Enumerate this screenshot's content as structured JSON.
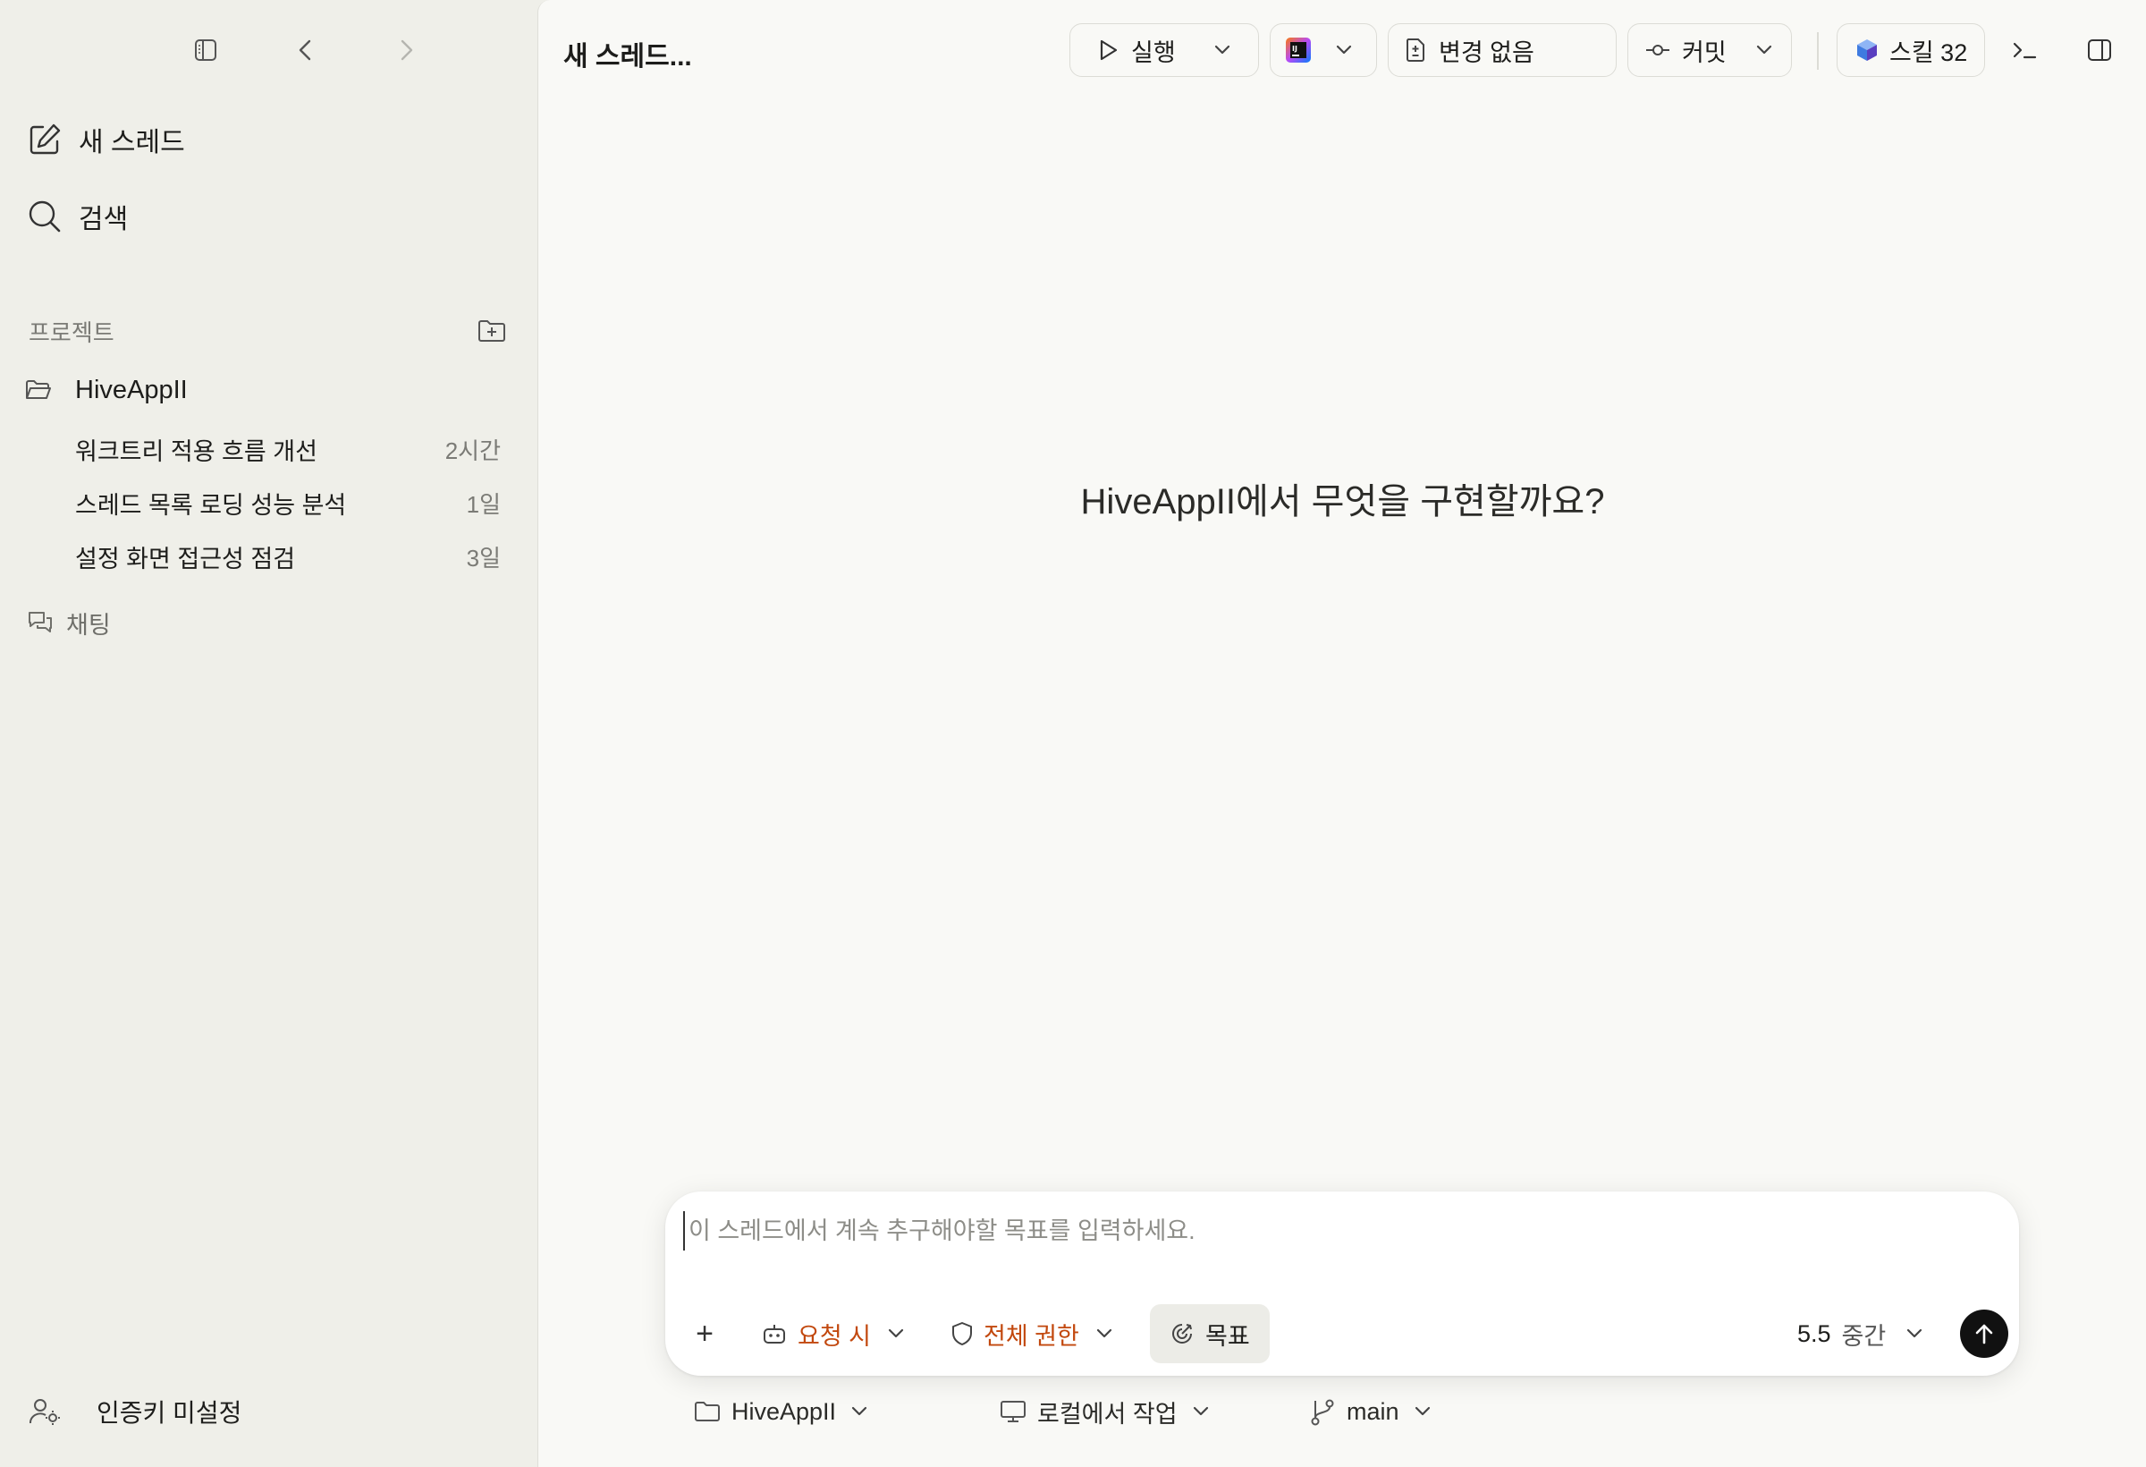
{
  "sidebar": {
    "nav": {
      "new_thread": "새 스레드",
      "search": "검색"
    },
    "projects_label": "프로젝트",
    "project": {
      "name": "HiveAppII",
      "threads": [
        {
          "title": "워크트리 적용 흐름 개선",
          "age": "2시간"
        },
        {
          "title": "스레드 목록 로딩 성능 분석",
          "age": "1일"
        },
        {
          "title": "설정 화면 접근성 점검",
          "age": "3일"
        }
      ]
    },
    "chat_label": "채팅",
    "auth_label": "인증키 미설정"
  },
  "header": {
    "thread_title": "새 스레드...",
    "run_label": "실행",
    "changes_label": "변경 없음",
    "commit_label": "커밋",
    "skills_label": "스킬 32"
  },
  "main": {
    "headline": "HiveAppII에서 무엇을 구현할까요?"
  },
  "composer": {
    "placeholder": "이 스레드에서 계속 추구해야할 목표를 입력하세요.",
    "plus": "+",
    "approval_label": "요청 시",
    "permission_label": "전체 권한",
    "goal_label": "목표",
    "model_version": "5.5",
    "model_effort": "중간"
  },
  "footer": {
    "project": "HiveAppII",
    "environment": "로컬에서 작업",
    "branch": "main"
  },
  "colors": {
    "accent_orange": "#c2480e",
    "sidebar_bg": "#efefe9",
    "main_bg": "#f9f9f6",
    "send_button": "#111111"
  }
}
